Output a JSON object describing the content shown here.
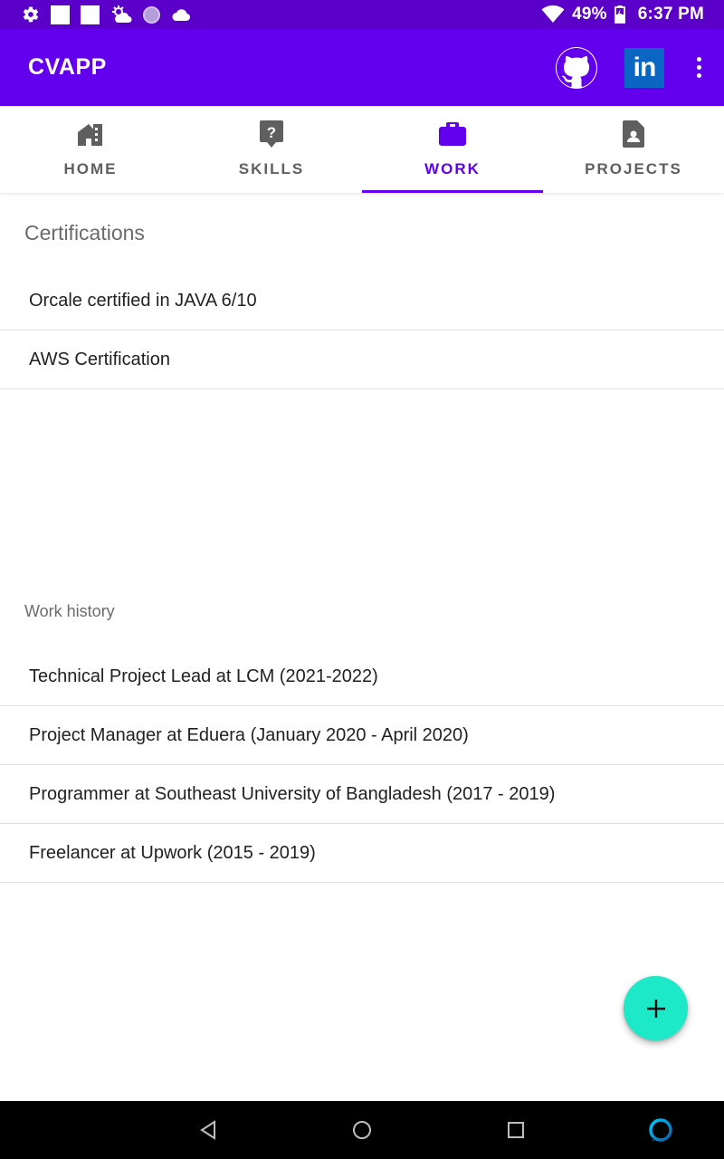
{
  "status_bar": {
    "battery_percent": "49%",
    "time": "6:37 PM",
    "icons": [
      "settings-icon",
      "notification-square-icon",
      "notification-square-icon",
      "weather-icon",
      "circle-icon",
      "cloud-icon",
      "wifi-icon",
      "battery-icon"
    ]
  },
  "app_bar": {
    "title": "CVAPP",
    "actions": [
      "github-icon",
      "linkedin-icon",
      "overflow-menu-icon"
    ],
    "linkedin_text": "in"
  },
  "tabs": [
    {
      "label": "HOME",
      "icon": "home-icon",
      "active": false
    },
    {
      "label": "SKILLS",
      "icon": "help-icon",
      "active": false
    },
    {
      "label": "WORK",
      "icon": "briefcase-icon",
      "active": true
    },
    {
      "label": "PROJECTS",
      "icon": "document-icon",
      "active": false
    }
  ],
  "certifications": {
    "title": "Certifications",
    "items": [
      "Orcale certified in JAVA 6/10",
      "AWS Certification"
    ]
  },
  "work_history": {
    "title": "Work history",
    "items": [
      "Technical Project Lead at LCM (2021-2022)",
      "Project Manager at Eduera (January 2020 - April 2020)",
      "Programmer at Southeast University of Bangladesh (2017 - 2019)",
      "Freelancer at Upwork (2015 - 2019)"
    ]
  },
  "fab": {
    "icon": "add-icon"
  },
  "colors": {
    "status_bar": "#5b00c9",
    "app_bar": "#6200ee",
    "accent": "#6200ee",
    "fab": "#1de9c8"
  },
  "nav_bar": {
    "buttons": [
      "back-icon",
      "home-circle-icon",
      "recents-icon",
      "assistant-icon"
    ]
  }
}
